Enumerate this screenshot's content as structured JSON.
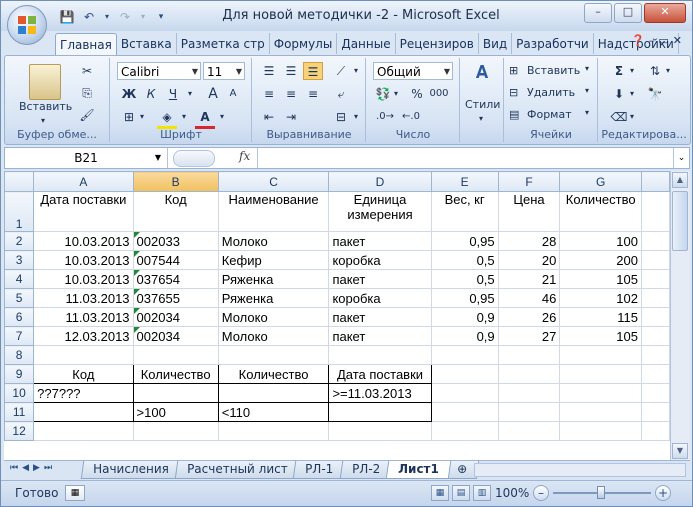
{
  "window": {
    "title": "Для новой методички -2 - Microsoft Excel",
    "controls": {
      "minimize": "–",
      "maximize": "□",
      "close": "✕"
    }
  },
  "ribbon_tabs": [
    "Главная",
    "Вставка",
    "Разметка стр",
    "Формулы",
    "Данные",
    "Рецензиров",
    "Вид",
    "Разработчи",
    "Надстройки"
  ],
  "active_tab": "Главная",
  "ribbon": {
    "clipboard": {
      "label": "Буфер обме...",
      "paste": "Вставить"
    },
    "font": {
      "label": "Шрифт",
      "name": "Calibri",
      "size": "11",
      "bold": "Ж",
      "italic": "К",
      "underline": "Ч",
      "grow": "A",
      "shrink": "A"
    },
    "alignment": {
      "label": "Выравнивание"
    },
    "number": {
      "label": "Число",
      "format": "Общий",
      "percent": "%",
      "thousands": "000"
    },
    "styles": {
      "label": "Стили"
    },
    "cells": {
      "label": "Ячейки",
      "insert": "Вставить",
      "delete": "Удалить",
      "format": "Формат"
    },
    "editing": {
      "label": "Редактирова..."
    }
  },
  "formula_bar": {
    "name_box": "B21",
    "fx": "fx",
    "formula": ""
  },
  "columns": [
    "A",
    "B",
    "C",
    "D",
    "E",
    "F",
    "G"
  ],
  "selected_column": "B",
  "rows": [
    {
      "n": "1",
      "cells": [
        "Дата поставки",
        "Код",
        "Наименование",
        "Единица",
        "Вес, кг",
        "Цена",
        "Количество"
      ],
      "cells2": [
        "",
        "",
        "",
        "измерения",
        "",
        "",
        ""
      ]
    },
    {
      "n": "2",
      "cells": [
        "10.03.2013",
        "002033",
        "Молоко",
        "пакет",
        "0,95",
        "28",
        "100"
      ]
    },
    {
      "n": "3",
      "cells": [
        "10.03.2013",
        "007544",
        "Кефир",
        "коробка",
        "0,5",
        "20",
        "200"
      ]
    },
    {
      "n": "4",
      "cells": [
        "10.03.2013",
        "037654",
        "Ряженка",
        "пакет",
        "0,5",
        "21",
        "105"
      ]
    },
    {
      "n": "5",
      "cells": [
        "11.03.2013",
        "037655",
        "Ряженка",
        "коробка",
        "0,95",
        "46",
        "102"
      ]
    },
    {
      "n": "6",
      "cells": [
        "11.03.2013",
        "002034",
        "Молоко",
        "пакет",
        "0,9",
        "26",
        "115"
      ]
    },
    {
      "n": "7",
      "cells": [
        "12.03.2013",
        "002034",
        "Молоко",
        "пакет",
        "0,9",
        "27",
        "105"
      ]
    },
    {
      "n": "8",
      "cells": [
        "",
        "",
        "",
        "",
        "",
        "",
        ""
      ]
    },
    {
      "n": "9",
      "cells": [
        "Код",
        "Количество",
        "Количество",
        "Дата поставки",
        "",
        "",
        ""
      ]
    },
    {
      "n": "10",
      "cells": [
        "??7???",
        "",
        "",
        ">=11.03.2013",
        "",
        "",
        ""
      ]
    },
    {
      "n": "11",
      "cells": [
        "",
        ">100",
        "<110",
        "",
        "",
        "",
        ""
      ]
    },
    {
      "n": "12",
      "cells": [
        "",
        "",
        "",
        "",
        "",
        "",
        ""
      ]
    }
  ],
  "sheet_tabs": [
    "Начисления",
    "Расчетный лист",
    "РЛ-1",
    "РЛ-2",
    "Лист1"
  ],
  "active_sheet": "Лист1",
  "status": {
    "ready": "Готово",
    "zoom": "100%"
  },
  "colors": {
    "accent": "#f1c15f",
    "grid": "#d0d7e5",
    "header": "#dde8f5",
    "comment_marker": "#1f8a3b"
  }
}
